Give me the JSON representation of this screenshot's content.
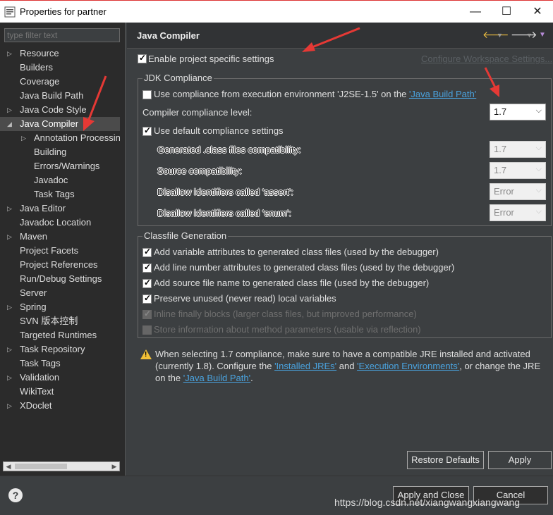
{
  "window": {
    "title": "Properties for partner",
    "minimize": "—",
    "maximize": "☐",
    "close": "✕"
  },
  "filter": {
    "placeholder": "type filter text"
  },
  "tree": [
    {
      "label": "Resource",
      "twisty": "▷",
      "level": 0
    },
    {
      "label": "Builders",
      "twisty": "",
      "level": 0
    },
    {
      "label": "Coverage",
      "twisty": "",
      "level": 0
    },
    {
      "label": "Java Build Path",
      "twisty": "",
      "level": 0
    },
    {
      "label": "Java Code Style",
      "twisty": "▷",
      "level": 0
    },
    {
      "label": "Java Compiler",
      "twisty": "◢",
      "level": 0,
      "selected": true
    },
    {
      "label": "Annotation Processin",
      "twisty": "▷",
      "level": 1
    },
    {
      "label": "Building",
      "twisty": "",
      "level": 1
    },
    {
      "label": "Errors/Warnings",
      "twisty": "",
      "level": 1
    },
    {
      "label": "Javadoc",
      "twisty": "",
      "level": 1
    },
    {
      "label": "Task Tags",
      "twisty": "",
      "level": 1
    },
    {
      "label": "Java Editor",
      "twisty": "▷",
      "level": 0
    },
    {
      "label": "Javadoc Location",
      "twisty": "",
      "level": 0
    },
    {
      "label": "Maven",
      "twisty": "▷",
      "level": 0
    },
    {
      "label": "Project Facets",
      "twisty": "",
      "level": 0
    },
    {
      "label": "Project References",
      "twisty": "",
      "level": 0
    },
    {
      "label": "Run/Debug Settings",
      "twisty": "",
      "level": 0
    },
    {
      "label": "Server",
      "twisty": "",
      "level": 0
    },
    {
      "label": "Spring",
      "twisty": "▷",
      "level": 0
    },
    {
      "label": "SVN 版本控制",
      "twisty": "",
      "level": 0
    },
    {
      "label": "Targeted Runtimes",
      "twisty": "",
      "level": 0
    },
    {
      "label": "Task Repository",
      "twisty": "▷",
      "level": 0
    },
    {
      "label": "Task Tags",
      "twisty": "",
      "level": 0
    },
    {
      "label": "Validation",
      "twisty": "▷",
      "level": 0
    },
    {
      "label": "WikiText",
      "twisty": "",
      "level": 0
    },
    {
      "label": "XDoclet",
      "twisty": "▷",
      "level": 0
    }
  ],
  "pane": {
    "title": "Java Compiler",
    "enable_specific": "Enable project specific settings",
    "configure_link": "Configure Workspace Settings...",
    "jdk": {
      "group_title": "JDK Compliance",
      "use_env_prefix": "Use compliance from execution environment 'J2SE-1.5' on the ",
      "use_env_link": "'Java Build Path'",
      "level_label": "Compiler compliance level:",
      "level_value": "1.7",
      "use_default": "Use default compliance settings",
      "generated_label": "Generated .class files compatibility:",
      "generated_value": "1.7",
      "source_label": "Source compatibility:",
      "source_value": "1.7",
      "assert_label": "Disallow identifiers called 'assert':",
      "assert_value": "Error",
      "enum_label": "Disallow identifiers called 'enum':",
      "enum_value": "Error"
    },
    "classfile": {
      "group_title": "Classfile Generation",
      "opt1": "Add variable attributes to generated class files (used by the debugger)",
      "opt2": "Add line number attributes to generated class files (used by the debugger)",
      "opt3": "Add source file name to generated class file (used by the debugger)",
      "opt4": "Preserve unused (never read) local variables",
      "opt5": "Inline finally blocks (larger class files, but improved performance)",
      "opt6": "Store information about method parameters (usable via reflection)"
    },
    "warning": {
      "line1": "When selecting 1.7 compliance, make sure to have a compatible JRE installed and activated",
      "line2_a": "(currently 1.8). Configure the ",
      "line2_link1": "'Installed JREs'",
      "line2_b": " and ",
      "line2_link2": "'Execution Environments'",
      "line2_c": ", or change the JRE",
      "line3_a": "on the ",
      "line3_link": "'Java Build Path'",
      "line3_b": "."
    },
    "restore_defaults": "Restore Defaults",
    "apply": "Apply"
  },
  "bottom": {
    "help": "?",
    "apply_close": "Apply and Close",
    "cancel": "Cancel",
    "watermark": "https://blog.csdn.net/xiangwangxiangwang"
  },
  "colors": {
    "annotation_arrow": "#e53935",
    "link": "#4aa3df",
    "warning": "#f2c037"
  }
}
